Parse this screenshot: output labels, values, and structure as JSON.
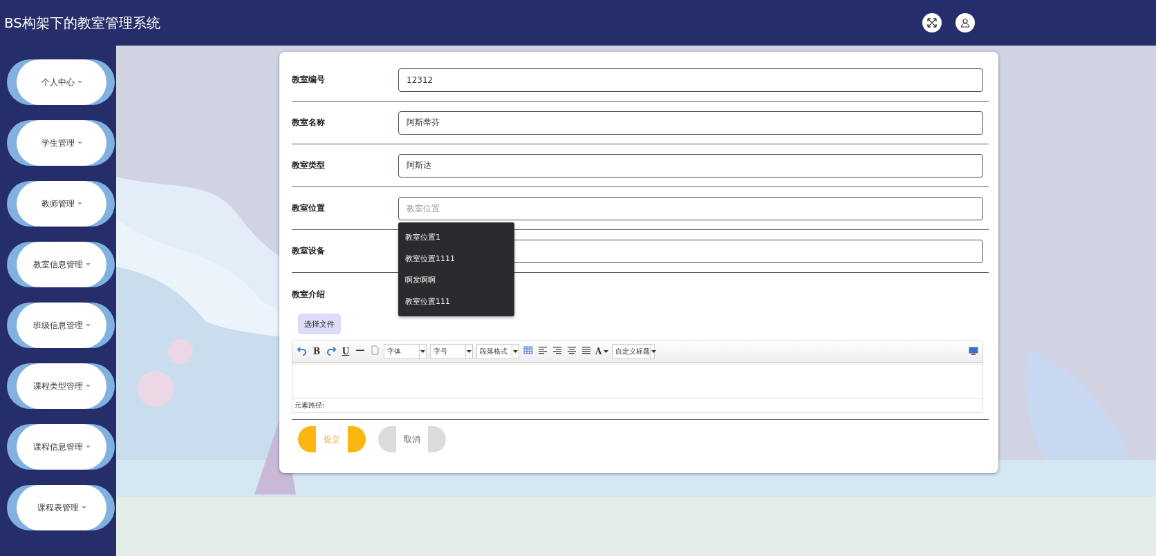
{
  "header": {
    "title": "BS构架下的教室管理系统"
  },
  "sidebar": {
    "items": [
      {
        "label": "个人中心"
      },
      {
        "label": "学生管理"
      },
      {
        "label": "教师管理"
      },
      {
        "label": "教室信息管理"
      },
      {
        "label": "班级信息管理"
      },
      {
        "label": "课程类型管理"
      },
      {
        "label": "课程信息管理"
      },
      {
        "label": "课程表管理"
      }
    ]
  },
  "form": {
    "fields": [
      {
        "label": "教室编号",
        "value": "12312"
      },
      {
        "label": "教室名称",
        "value": "阿斯蒂芬"
      },
      {
        "label": "教室类型",
        "value": "阿斯达"
      },
      {
        "label": "教室位置",
        "placeholder": "教室位置",
        "suggestions": [
          "教室位置1",
          "教室位置1111",
          "啊发啊啊",
          "教室位置111"
        ]
      },
      {
        "label": "教室设备"
      }
    ],
    "intro": {
      "label": "教室介绍",
      "upload_button": "选择文件",
      "toolbar": [
        {
          "kind": "undo"
        },
        {
          "kind": "glyph",
          "text": "B"
        },
        {
          "kind": "redo"
        },
        {
          "kind": "glyph",
          "text": "U",
          "underline": true
        },
        {
          "kind": "rule"
        },
        {
          "kind": "page"
        },
        {
          "kind": "select",
          "text": "字体"
        },
        {
          "kind": "select",
          "text": "字号"
        },
        {
          "kind": "select",
          "text": "段落格式"
        },
        {
          "kind": "table"
        },
        {
          "kind": "align-left"
        },
        {
          "kind": "align-right"
        },
        {
          "kind": "align-center"
        },
        {
          "kind": "justify"
        },
        {
          "kind": "color",
          "text": "A"
        },
        {
          "kind": "select",
          "text": "自定义标题"
        }
      ],
      "status": "元素路径:"
    },
    "buttons": [
      {
        "kind": "submit",
        "label": "提交"
      },
      {
        "kind": "cancel",
        "label": "取消"
      }
    ]
  }
}
